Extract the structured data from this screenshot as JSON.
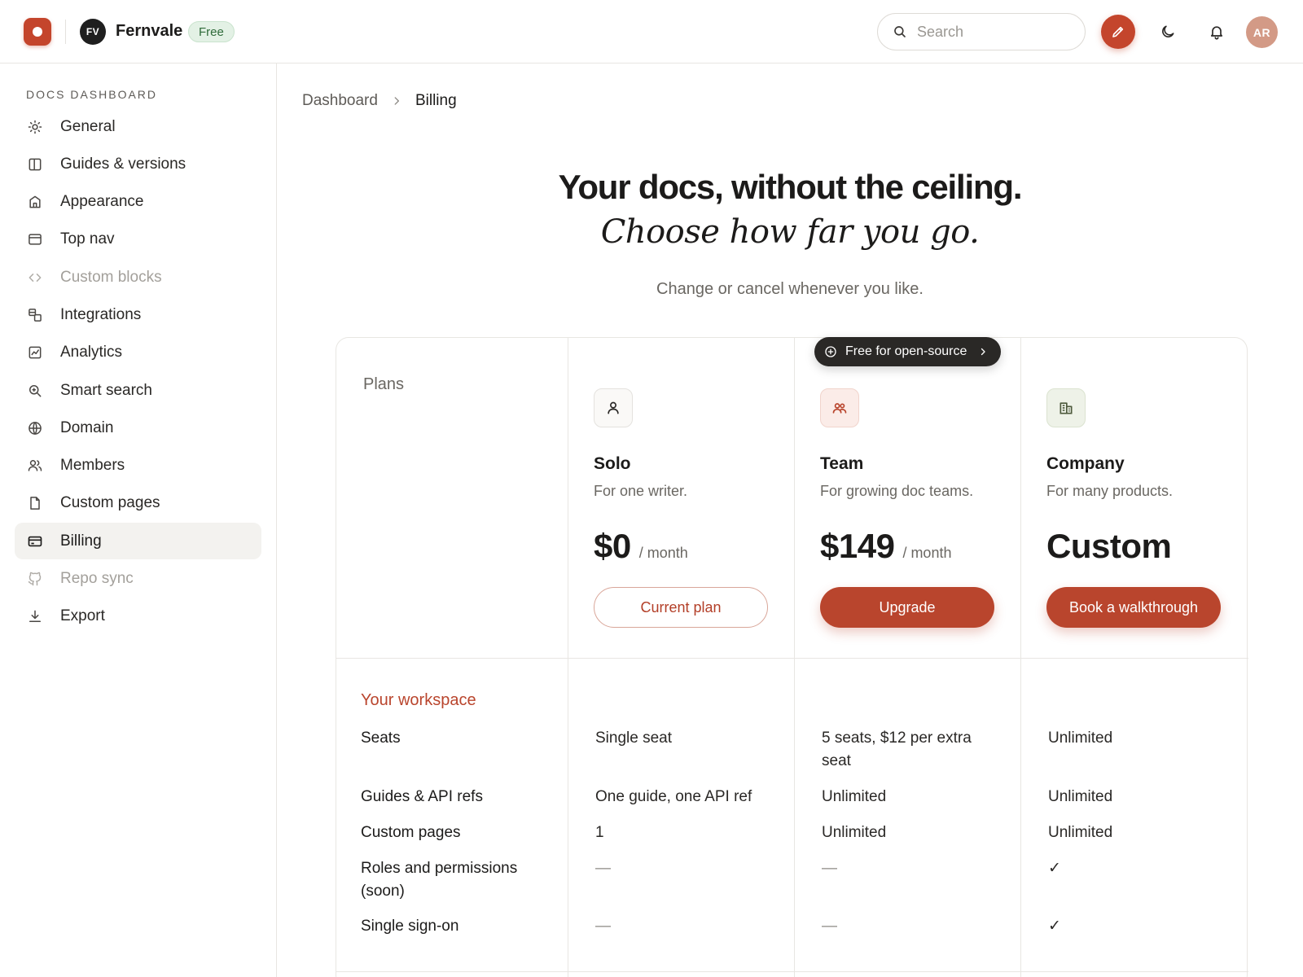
{
  "header": {
    "workspace_initials": "FV",
    "workspace_name": "Fernvale",
    "plan_badge": "Free",
    "search_placeholder": "Search",
    "user_initials": "AR"
  },
  "sidebar": {
    "heading": "DOCS DASHBOARD",
    "items": [
      {
        "label": "General",
        "icon": "sun-icon"
      },
      {
        "label": "Guides & versions",
        "icon": "book-icon"
      },
      {
        "label": "Appearance",
        "icon": "home-icon"
      },
      {
        "label": "Top nav",
        "icon": "window-icon"
      },
      {
        "label": "Custom blocks",
        "icon": "code-icon",
        "disabled": true
      },
      {
        "label": "Integrations",
        "icon": "integrations-icon"
      },
      {
        "label": "Analytics",
        "icon": "chart-icon"
      },
      {
        "label": "Smart search",
        "icon": "search-zoom-icon"
      },
      {
        "label": "Domain",
        "icon": "globe-icon"
      },
      {
        "label": "Members",
        "icon": "users-icon"
      },
      {
        "label": "Custom pages",
        "icon": "file-icon"
      },
      {
        "label": "Billing",
        "icon": "card-icon",
        "active": true
      },
      {
        "label": "Repo sync",
        "icon": "github-icon",
        "disabled": true
      },
      {
        "label": "Export",
        "icon": "download-icon"
      }
    ]
  },
  "breadcrumb": {
    "parent": "Dashboard",
    "current": "Billing"
  },
  "hero": {
    "title": "Your docs, without the ceiling.",
    "subtitle": "Choose how far you go.",
    "note": "Change or cancel whenever you like."
  },
  "pricing": {
    "plans_label": "Plans",
    "oss_badge": "Free for open-source",
    "plans": [
      {
        "name": "Solo",
        "desc": "For one writer.",
        "price": "$0",
        "period": "/ month",
        "cta": "Current plan",
        "icon": "user-icon"
      },
      {
        "name": "Team",
        "desc": "For growing doc teams.",
        "price": "$149",
        "period": "/ month",
        "cta": "Upgrade",
        "icon": "team-icon"
      },
      {
        "name": "Company",
        "desc": "For many products.",
        "price": "Custom",
        "period": "",
        "cta": "Book a walkthrough",
        "icon": "building-icon"
      }
    ],
    "section_title": "Your workspace",
    "features": [
      {
        "label": "Seats",
        "solo": "Single seat",
        "team": "5 seats, $12 per extra seat",
        "company": "Unlimited"
      },
      {
        "label": "Guides & API refs",
        "solo": "One guide, one API ref",
        "team": "Unlimited",
        "company": "Unlimited"
      },
      {
        "label": "Custom pages",
        "solo": "1",
        "team": "Unlimited",
        "company": "Unlimited"
      },
      {
        "label": "Roles and permissions (soon)",
        "solo": "—",
        "team": "—",
        "company": "✓"
      },
      {
        "label": "Single sign-on",
        "solo": "—",
        "team": "—",
        "company": "✓"
      }
    ]
  },
  "colors": {
    "accent": "#c4452c",
    "badge_green": "#2f6b3a"
  }
}
